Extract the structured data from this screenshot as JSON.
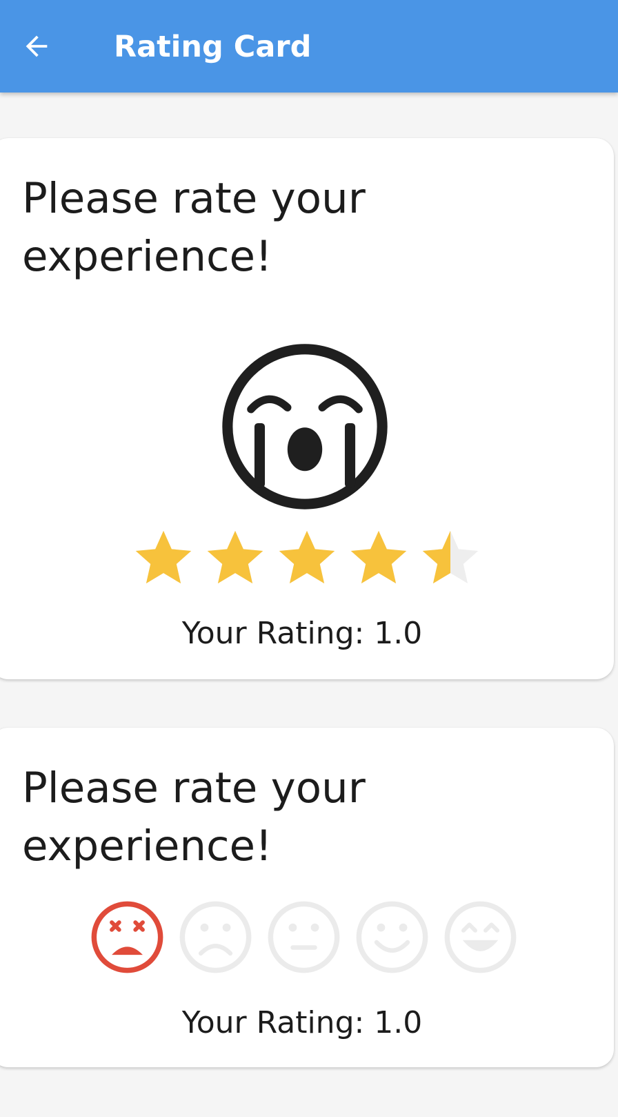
{
  "appbar": {
    "title": "Rating Card",
    "back_icon": "arrow-left-icon",
    "color": "#4a95e6"
  },
  "star_card": {
    "heading": "Please rate your experience!",
    "emoji_icon": "crying-face-icon",
    "stars_total": 5,
    "stars_filled_fraction": 0.9,
    "star_color": "#f7c23c",
    "rating_label": "Your Rating: 1.0"
  },
  "emoji_card": {
    "heading": "Please rate your experience!",
    "faces": [
      {
        "name": "dizzy-face-icon",
        "selected": true
      },
      {
        "name": "sad-face-icon",
        "selected": false
      },
      {
        "name": "neutral-face-icon",
        "selected": false
      },
      {
        "name": "smile-face-icon",
        "selected": false
      },
      {
        "name": "happy-face-icon",
        "selected": false
      }
    ],
    "selected_color": "#e04b3a",
    "unselected_color": "#ebebeb",
    "rating_label": "Your Rating: 1.0"
  }
}
